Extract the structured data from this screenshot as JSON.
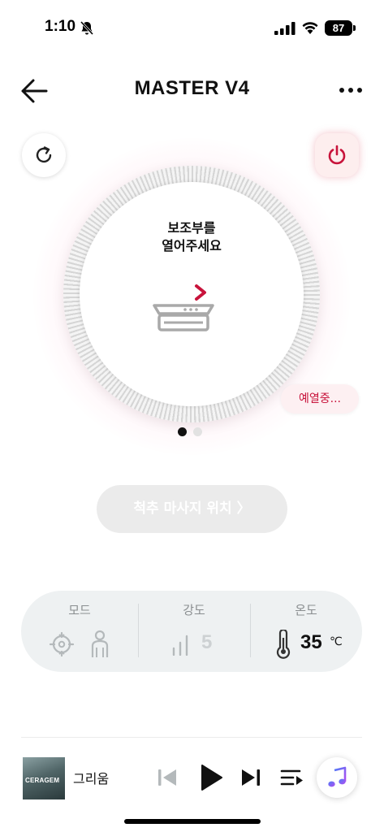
{
  "status_bar": {
    "time": "1:10",
    "battery": "87",
    "icons": [
      "bell-slash-icon",
      "cellular-signal-icon",
      "wifi-icon",
      "battery-icon"
    ]
  },
  "header": {
    "title": "MASTER V4",
    "back_icon": "arrow-left-icon",
    "more_icon": "ellipsis-icon"
  },
  "controls": {
    "refresh_icon": "refresh-icon",
    "power_icon": "power-icon"
  },
  "dial": {
    "message": "보조부를\n열어주세요",
    "icon": "slide-out-tray-icon"
  },
  "status": {
    "preheating": "예열중..."
  },
  "pager": {
    "total": 2,
    "active": 1
  },
  "spine_button": {
    "label": "척추 마사지 위치 〉"
  },
  "info": {
    "mode": {
      "label": "모드"
    },
    "intensity": {
      "label": "강도",
      "value": "5"
    },
    "temperature": {
      "label": "온도",
      "value": "35",
      "unit": "℃"
    }
  },
  "player": {
    "album_label": "CERAGEM",
    "track_title": "그리움"
  },
  "colors": {
    "accent_red": "#c8133b",
    "card_bg": "#eef1f2",
    "music_purple": "#7b5cf0"
  }
}
